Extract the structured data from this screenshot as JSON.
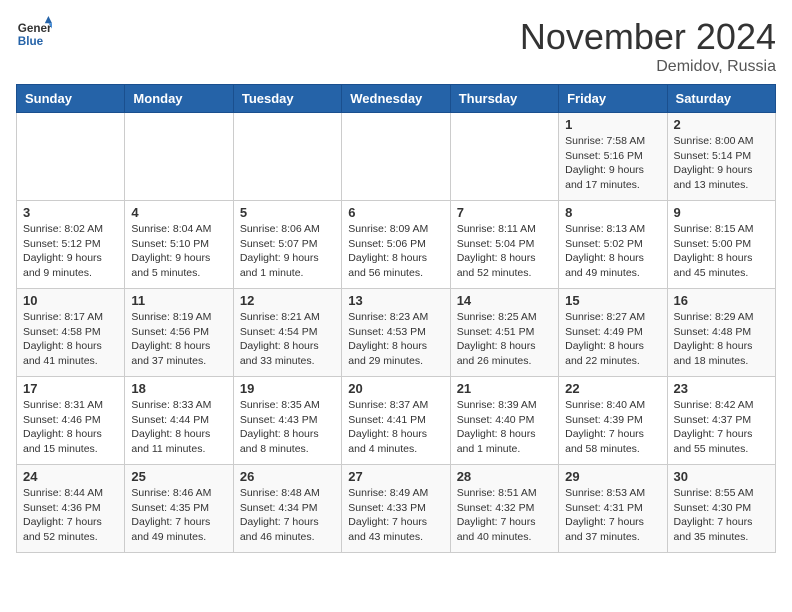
{
  "logo": {
    "text_general": "General",
    "text_blue": "Blue"
  },
  "header": {
    "month": "November 2024",
    "location": "Demidov, Russia"
  },
  "weekdays": [
    "Sunday",
    "Monday",
    "Tuesday",
    "Wednesday",
    "Thursday",
    "Friday",
    "Saturday"
  ],
  "weeks": [
    [
      {
        "day": "",
        "info": ""
      },
      {
        "day": "",
        "info": ""
      },
      {
        "day": "",
        "info": ""
      },
      {
        "day": "",
        "info": ""
      },
      {
        "day": "",
        "info": ""
      },
      {
        "day": "1",
        "info": "Sunrise: 7:58 AM\nSunset: 5:16 PM\nDaylight: 9 hours and 17 minutes."
      },
      {
        "day": "2",
        "info": "Sunrise: 8:00 AM\nSunset: 5:14 PM\nDaylight: 9 hours and 13 minutes."
      }
    ],
    [
      {
        "day": "3",
        "info": "Sunrise: 8:02 AM\nSunset: 5:12 PM\nDaylight: 9 hours and 9 minutes."
      },
      {
        "day": "4",
        "info": "Sunrise: 8:04 AM\nSunset: 5:10 PM\nDaylight: 9 hours and 5 minutes."
      },
      {
        "day": "5",
        "info": "Sunrise: 8:06 AM\nSunset: 5:07 PM\nDaylight: 9 hours and 1 minute."
      },
      {
        "day": "6",
        "info": "Sunrise: 8:09 AM\nSunset: 5:06 PM\nDaylight: 8 hours and 56 minutes."
      },
      {
        "day": "7",
        "info": "Sunrise: 8:11 AM\nSunset: 5:04 PM\nDaylight: 8 hours and 52 minutes."
      },
      {
        "day": "8",
        "info": "Sunrise: 8:13 AM\nSunset: 5:02 PM\nDaylight: 8 hours and 49 minutes."
      },
      {
        "day": "9",
        "info": "Sunrise: 8:15 AM\nSunset: 5:00 PM\nDaylight: 8 hours and 45 minutes."
      }
    ],
    [
      {
        "day": "10",
        "info": "Sunrise: 8:17 AM\nSunset: 4:58 PM\nDaylight: 8 hours and 41 minutes."
      },
      {
        "day": "11",
        "info": "Sunrise: 8:19 AM\nSunset: 4:56 PM\nDaylight: 8 hours and 37 minutes."
      },
      {
        "day": "12",
        "info": "Sunrise: 8:21 AM\nSunset: 4:54 PM\nDaylight: 8 hours and 33 minutes."
      },
      {
        "day": "13",
        "info": "Sunrise: 8:23 AM\nSunset: 4:53 PM\nDaylight: 8 hours and 29 minutes."
      },
      {
        "day": "14",
        "info": "Sunrise: 8:25 AM\nSunset: 4:51 PM\nDaylight: 8 hours and 26 minutes."
      },
      {
        "day": "15",
        "info": "Sunrise: 8:27 AM\nSunset: 4:49 PM\nDaylight: 8 hours and 22 minutes."
      },
      {
        "day": "16",
        "info": "Sunrise: 8:29 AM\nSunset: 4:48 PM\nDaylight: 8 hours and 18 minutes."
      }
    ],
    [
      {
        "day": "17",
        "info": "Sunrise: 8:31 AM\nSunset: 4:46 PM\nDaylight: 8 hours and 15 minutes."
      },
      {
        "day": "18",
        "info": "Sunrise: 8:33 AM\nSunset: 4:44 PM\nDaylight: 8 hours and 11 minutes."
      },
      {
        "day": "19",
        "info": "Sunrise: 8:35 AM\nSunset: 4:43 PM\nDaylight: 8 hours and 8 minutes."
      },
      {
        "day": "20",
        "info": "Sunrise: 8:37 AM\nSunset: 4:41 PM\nDaylight: 8 hours and 4 minutes."
      },
      {
        "day": "21",
        "info": "Sunrise: 8:39 AM\nSunset: 4:40 PM\nDaylight: 8 hours and 1 minute."
      },
      {
        "day": "22",
        "info": "Sunrise: 8:40 AM\nSunset: 4:39 PM\nDaylight: 7 hours and 58 minutes."
      },
      {
        "day": "23",
        "info": "Sunrise: 8:42 AM\nSunset: 4:37 PM\nDaylight: 7 hours and 55 minutes."
      }
    ],
    [
      {
        "day": "24",
        "info": "Sunrise: 8:44 AM\nSunset: 4:36 PM\nDaylight: 7 hours and 52 minutes."
      },
      {
        "day": "25",
        "info": "Sunrise: 8:46 AM\nSunset: 4:35 PM\nDaylight: 7 hours and 49 minutes."
      },
      {
        "day": "26",
        "info": "Sunrise: 8:48 AM\nSunset: 4:34 PM\nDaylight: 7 hours and 46 minutes."
      },
      {
        "day": "27",
        "info": "Sunrise: 8:49 AM\nSunset: 4:33 PM\nDaylight: 7 hours and 43 minutes."
      },
      {
        "day": "28",
        "info": "Sunrise: 8:51 AM\nSunset: 4:32 PM\nDaylight: 7 hours and 40 minutes."
      },
      {
        "day": "29",
        "info": "Sunrise: 8:53 AM\nSunset: 4:31 PM\nDaylight: 7 hours and 37 minutes."
      },
      {
        "day": "30",
        "info": "Sunrise: 8:55 AM\nSunset: 4:30 PM\nDaylight: 7 hours and 35 minutes."
      }
    ]
  ]
}
